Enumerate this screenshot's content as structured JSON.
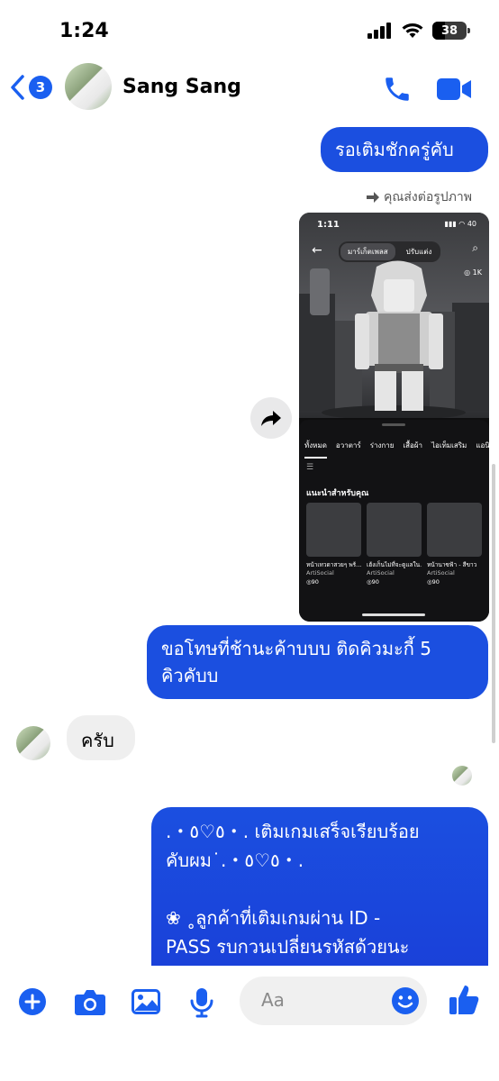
{
  "status_bar": {
    "time": "1:24",
    "battery": "38"
  },
  "header": {
    "back_badge": "3",
    "contact_name": "Sang Sang"
  },
  "messages": {
    "m1": "รอเติมชักครู่คับ",
    "forward_label": "คุณส่งต่อรูปภาพ",
    "m2_line1": "ขอโทษที่ช้านะค้าบบบ ติดคิวมะกี้ 5",
    "m2_line2": "คิวคับบ",
    "m3": "ครับ",
    "m4_line1": ".・٥♡٥・. เติมเกมเสร็จเรียบร้อย",
    "m4_line2": "คับผม˙.・٥♡٥・.",
    "m4_line3": "❀ ˳ลูกค้าที่เติมเกมผ่าน ID -",
    "m4_line4": "PASS รบกวนเปลี่ยนรหัสด้วยนะ"
  },
  "shared_image": {
    "time": "1:11",
    "status": "▮▮▮ ◠ 40",
    "tabs": [
      "มาร์เก็ตเพลส",
      "ปรับแต่ง"
    ],
    "coin": "1K",
    "categories": [
      "ทั้งหมด",
      "อวาตาร์",
      "ร่างกาย",
      "เสื้อผ้า",
      "ไอเท็มเสริม",
      "แอนิ"
    ],
    "section_title": "แนะนำสำหรับคุณ",
    "items": [
      {
        "name": "หน้าเทวดาสวยๆ พร้...",
        "seller": "ArtiSocial",
        "price": "◎90"
      },
      {
        "name": "เฮ้งเก็นไม่ที่จะดูแลใน...",
        "seller": "ArtiSocial",
        "price": "◎90"
      },
      {
        "name": "หน้านาซฟ้า - สีขาว",
        "seller": "ArtiSocial",
        "price": "◎90"
      }
    ]
  },
  "composer": {
    "placeholder": "Aa"
  },
  "colors": {
    "accent": "#1a5ff0",
    "bubble_out": "#1b4fe0",
    "bubble_in": "#efefef"
  }
}
